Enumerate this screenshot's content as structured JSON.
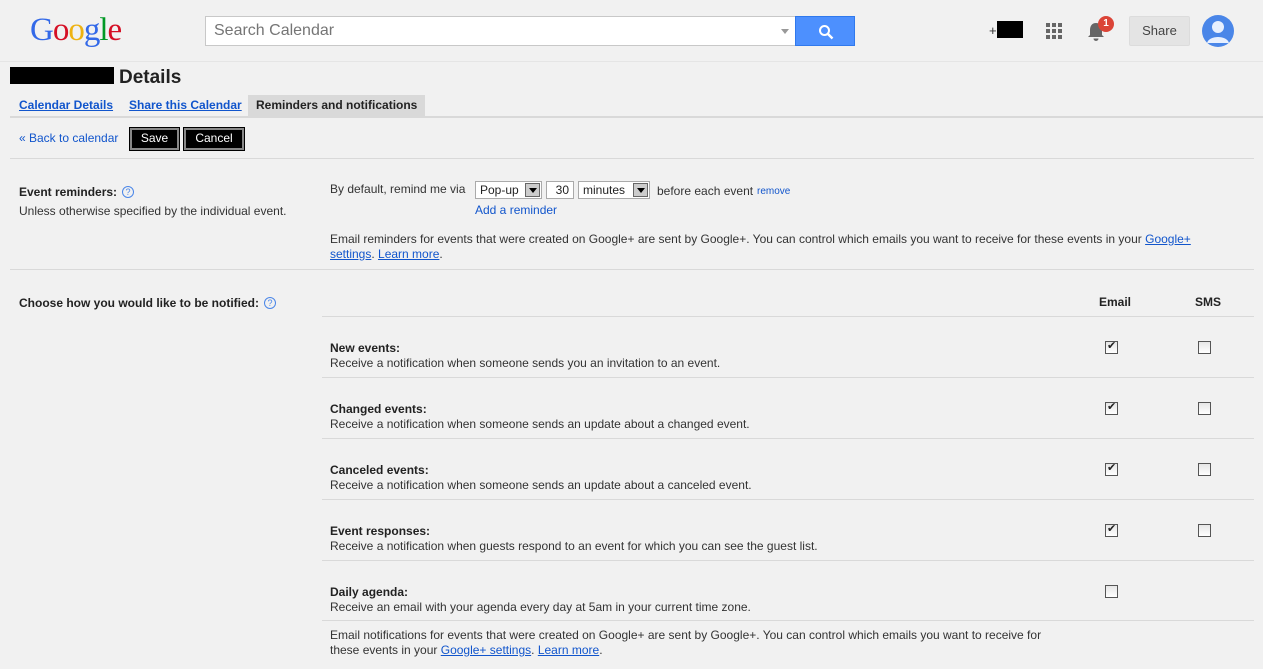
{
  "header": {
    "logo_letters": [
      {
        "ch": "G",
        "color": "#3369e8"
      },
      {
        "ch": "o",
        "color": "#d50f25"
      },
      {
        "ch": "o",
        "color": "#eeb211"
      },
      {
        "ch": "g",
        "color": "#3369e8"
      },
      {
        "ch": "l",
        "color": "#009925"
      },
      {
        "ch": "e",
        "color": "#d50f25"
      }
    ],
    "search_placeholder": "Search Calendar",
    "plus_prefix": "+",
    "notification_count": "1",
    "share_label": "Share"
  },
  "page": {
    "title": "Details",
    "tabs": [
      {
        "label": "Calendar Details",
        "active": false
      },
      {
        "label": "Share this Calendar",
        "active": false
      },
      {
        "label": "Reminders and notifications",
        "active": true
      }
    ]
  },
  "toolbar": {
    "back_label": "« Back to calendar",
    "save_label": "Save",
    "cancel_label": "Cancel"
  },
  "reminders": {
    "heading": "Event reminders:",
    "help_glyph": "?",
    "subtext": "Unless otherwise specified by the individual event.",
    "prefix": "By default, remind me via",
    "method": "Pop-up",
    "amount": "30",
    "unit": "minutes",
    "suffix": "before each event",
    "remove_label": "remove",
    "add_label": "Add a reminder",
    "gplus_note_1": "Email reminders for events that were created on Google+ are sent by Google+. You can control which emails you want to receive for these events in your ",
    "gplus_link_1": "Google+",
    "gplus_link_2": "settings",
    "gplus_sep": ". ",
    "learn_more": "Learn more",
    "period": "."
  },
  "notifications": {
    "heading": "Choose how you would like to be notified:",
    "col_email": "Email",
    "col_sms": "SMS",
    "rows": [
      {
        "title": "New events:",
        "desc": "Receive a notification when someone sends you an invitation to an event.",
        "email": true,
        "sms": false
      },
      {
        "title": "Changed events:",
        "desc": "Receive a notification when someone sends an update about a changed event.",
        "email": true,
        "sms": false
      },
      {
        "title": "Canceled events:",
        "desc": "Receive a notification when someone sends an update about a canceled event.",
        "email": true,
        "sms": false
      },
      {
        "title": "Event responses:",
        "desc": "Receive a notification when guests respond to an event for which you can see the guest list.",
        "email": true,
        "sms": false
      },
      {
        "title": "Daily agenda:",
        "desc": "Receive an email with your agenda every day at 5am in your current time zone.",
        "email": false
      }
    ],
    "footer_1": "Email notifications for events that were created on Google+ are sent by Google+. You can control which emails you want to receive for",
    "footer_2": "these events in your ",
    "footer_link": "Google+ settings",
    "footer_sep": ". ",
    "footer_learn": "Learn more",
    "footer_end": "."
  }
}
